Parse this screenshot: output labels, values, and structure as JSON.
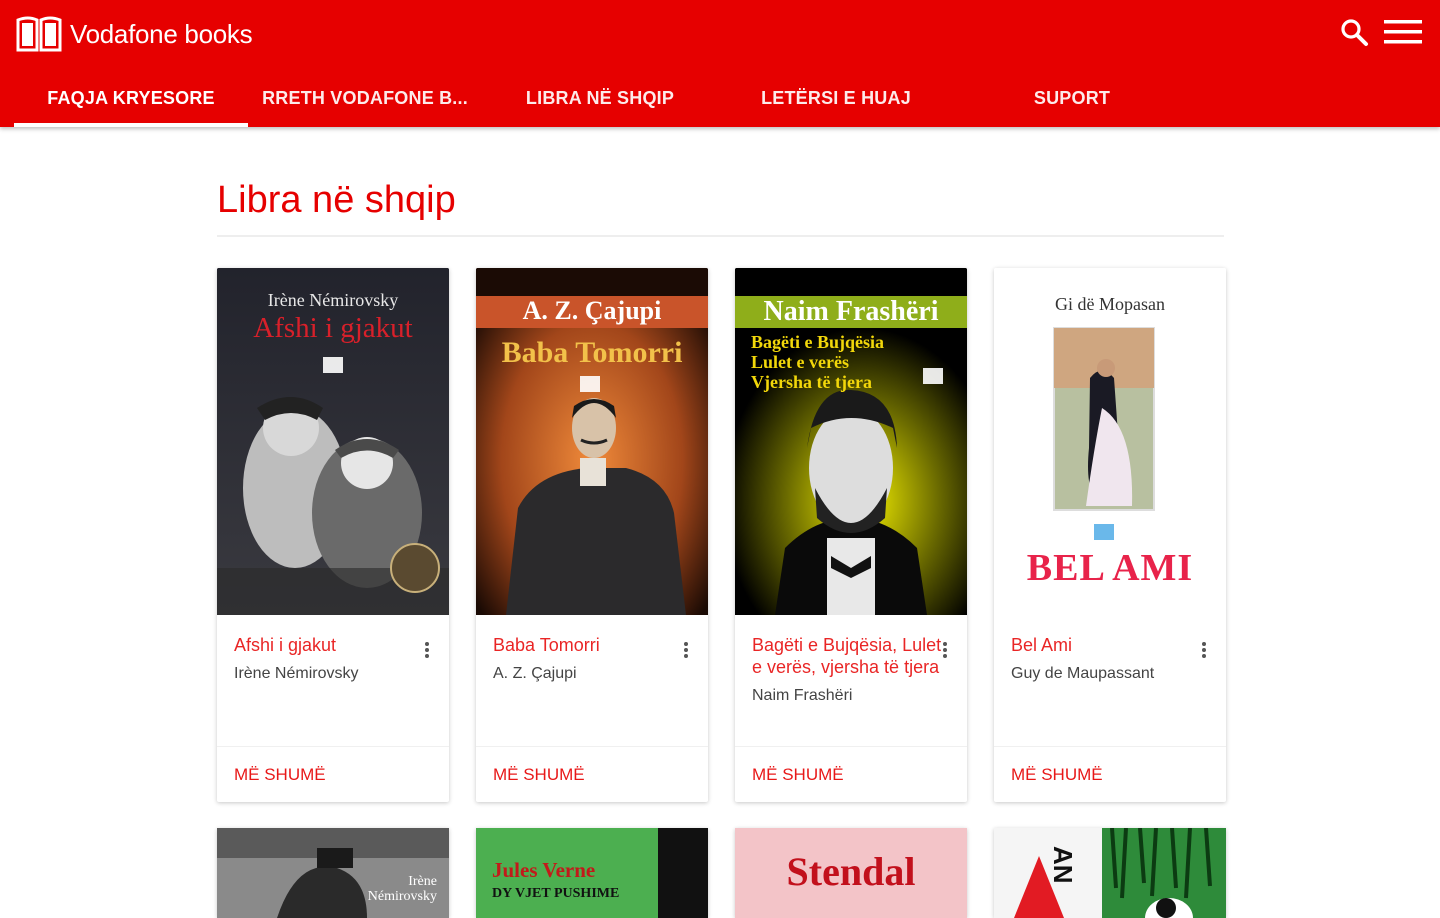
{
  "app": {
    "brand": "Vodafone books",
    "icons": [
      "book-logo-icon",
      "search-icon",
      "menu-icon"
    ]
  },
  "tabs": [
    {
      "label": "FAQJA KRYESORE",
      "active": true
    },
    {
      "label": "RRETH VODAFONE B...",
      "active": false
    },
    {
      "label": "LIBRA NË SHQIP",
      "active": false
    },
    {
      "label": "LETËRSI E HUAJ",
      "active": false
    },
    {
      "label": "SUPORT",
      "active": false
    }
  ],
  "page": {
    "title": "Libra në shqip"
  },
  "books": [
    {
      "title": "Afshi i gjakut",
      "author": "Irène Némirovsky",
      "more": "MË SHUMË",
      "cover": {
        "author": "Irène Némirovsky",
        "title": "Afshi i gjakut"
      }
    },
    {
      "title": "Baba Tomorri",
      "author": "A. Z. Çajupi",
      "more": "MË SHUMË",
      "cover": {
        "author": "A. Z. Çajupi",
        "title": "Baba Tomorri"
      }
    },
    {
      "title": "Bagëti e Bujqësia, Lulet e verës, vjersha të tjera",
      "author": "Naim Frashëri",
      "more": "MË SHUMË",
      "cover": {
        "author": "Naim Frashëri",
        "line1": "Bagëti e Bujqësia",
        "line2": "Lulet e verës",
        "line3": "Vjersha të tjera"
      }
    },
    {
      "title": "Bel Ami",
      "author": "Guy de Maupassant",
      "more": "MË SHUMË",
      "cover": {
        "author": "Gi dë Mopasan",
        "title": "BEL AMI"
      }
    }
  ],
  "next_row": [
    {
      "cover_text": "Irène Némirovsky"
    },
    {
      "cover_author": "Jules Verne",
      "cover_title": "DY VJET PUSHIME"
    },
    {
      "cover_title": "Stendal"
    },
    {
      "cover_text": "AN"
    }
  ],
  "colors": {
    "accent": "#e60000",
    "text": "#444444"
  }
}
